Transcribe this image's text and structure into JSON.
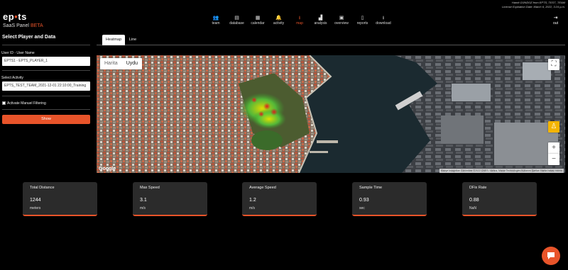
{
  "header": {
    "brand_main": "ep",
    "brand_dot": "•",
    "brand_tail": "ts",
    "brand_sub": "SaaS Panel",
    "brand_beta": "BETA",
    "user_line": "Hamit GÜNDÜZ from EPTS_TEST_TEAM",
    "license_line": "License Expiration Date: March 6, 2022, 3:24 p.m."
  },
  "nav": [
    {
      "label": "team",
      "icon": "team-icon",
      "glyph": "👥",
      "active": false
    },
    {
      "label": "database",
      "icon": "database-icon",
      "glyph": "▤",
      "active": false
    },
    {
      "label": "calendar",
      "icon": "calendar-icon",
      "glyph": "▦",
      "active": false
    },
    {
      "label": "activity",
      "icon": "bell-icon",
      "glyph": "🔔",
      "active": false
    },
    {
      "label": "map",
      "icon": "download-map-icon",
      "glyph": "⭳",
      "active": true
    },
    {
      "label": "analysis",
      "icon": "chart-icon",
      "glyph": "▟",
      "active": false
    },
    {
      "label": "overview",
      "icon": "overview-icon",
      "glyph": "▣",
      "active": false
    },
    {
      "label": "reports",
      "icon": "file-icon",
      "glyph": "▯",
      "active": false
    },
    {
      "label": "download",
      "icon": "download-icon",
      "glyph": "⭳",
      "active": false
    }
  ],
  "exit": {
    "label": "out",
    "icon": "logout-icon",
    "glyph": "⇥"
  },
  "left": {
    "title": "Select Player and Data",
    "user_label": "User ID - User Name",
    "user_value": "EPTS1 - EPTS_PLAYER_1",
    "activity_label": "Select Activity",
    "activity_value": "EPTS_TEST_TEAM_2021-12-01 22:10:00_Training",
    "manual_filter_label": "Activate Manuel Filtering",
    "show_label": "Show"
  },
  "tabs": [
    {
      "label": "Heatmap",
      "active": true
    },
    {
      "label": "Line",
      "active": false
    }
  ],
  "map": {
    "type_options": [
      "Harita",
      "Uydu"
    ],
    "selected_type": "Uydu",
    "google_label": "Google",
    "attribution": "Klavye kısayolları   Görüntüler ©2022 CNES / Airbus, Maxar Technologies   Kullanım Şartları   Harita hatası bildirin"
  },
  "stats": [
    {
      "title": "Total Distance",
      "value": "1244",
      "unit": "meters"
    },
    {
      "title": "Max Speed",
      "value": "3.1",
      "unit": "m/s"
    },
    {
      "title": "Average Speed",
      "value": "1.2",
      "unit": "m/s"
    },
    {
      "title": "Sample Time",
      "value": "0.93",
      "unit": "sec"
    },
    {
      "title": "DFix Rate",
      "value": "0.88",
      "unit": "NaN"
    }
  ],
  "colors": {
    "accent": "#e8542a",
    "card_bg": "#2b2b2b",
    "background": "#000000"
  }
}
